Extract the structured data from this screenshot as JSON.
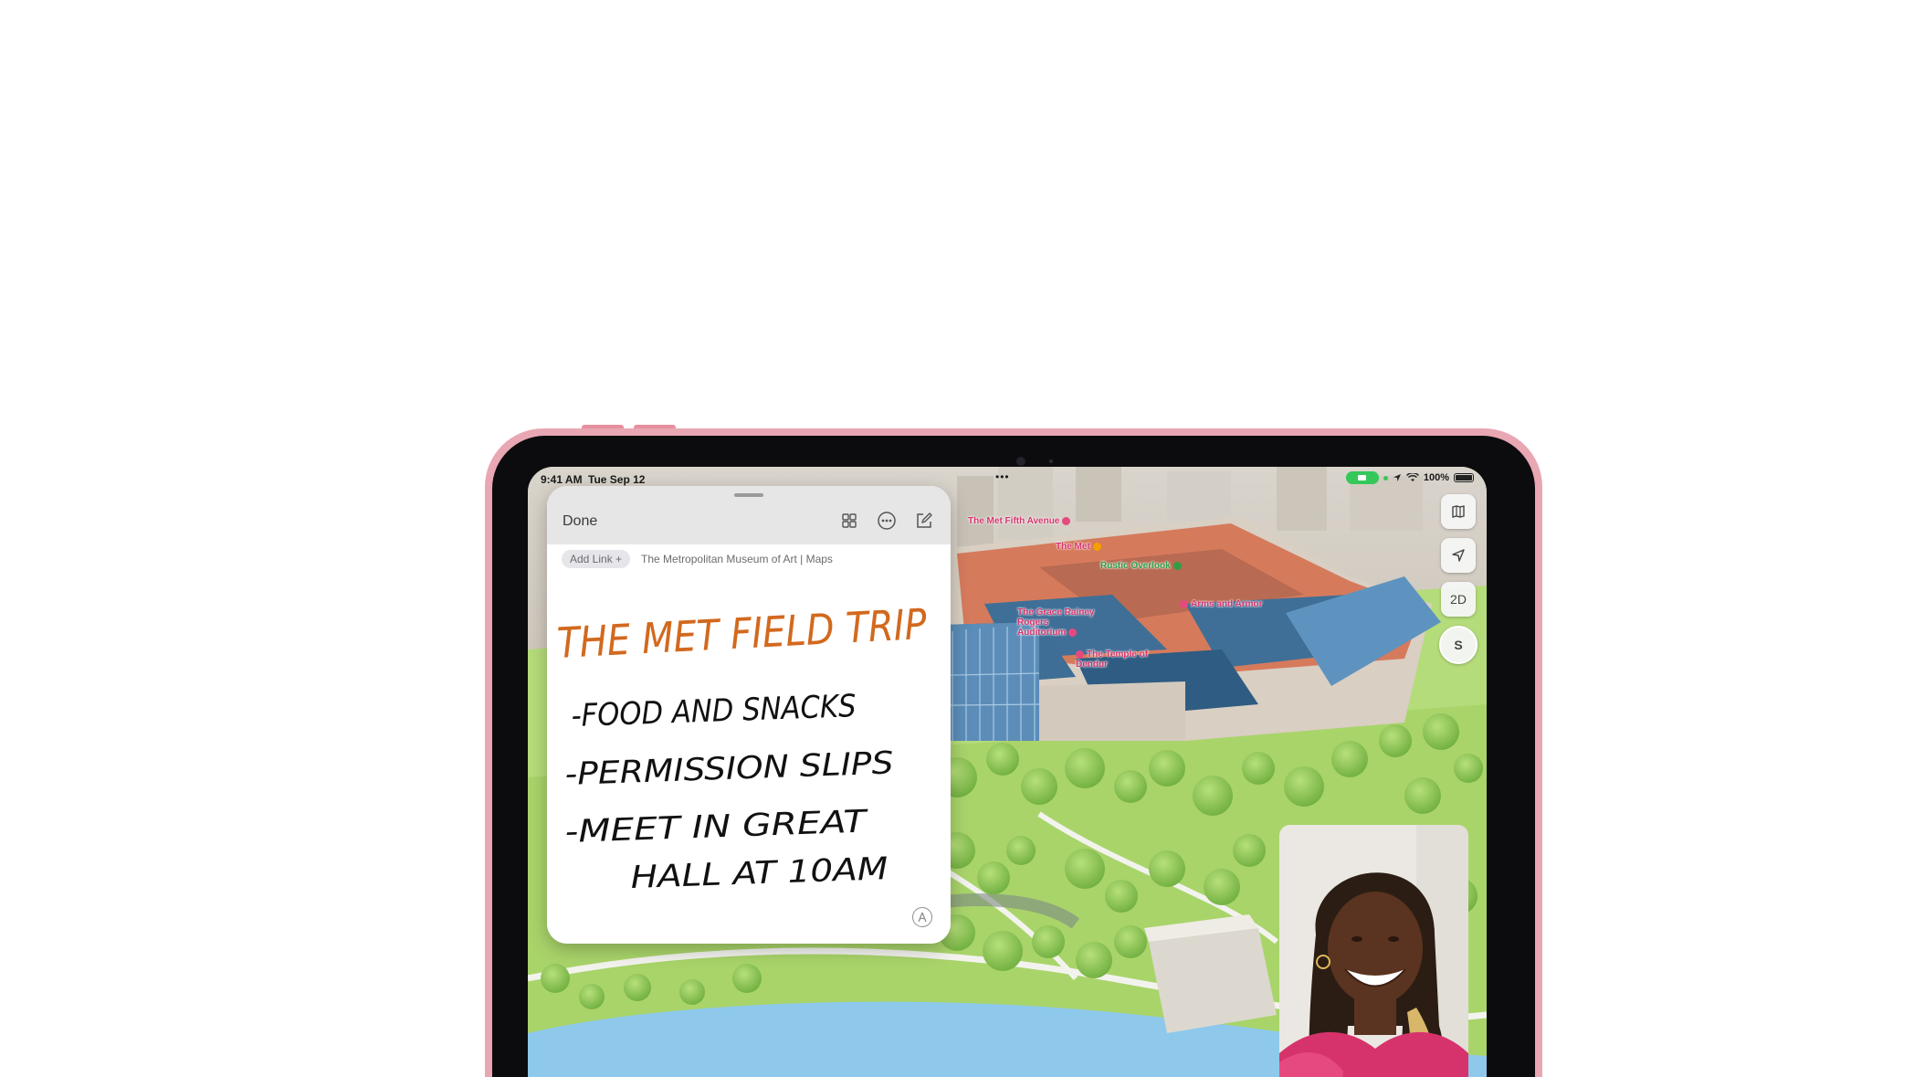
{
  "status_bar": {
    "time": "9:41 AM",
    "date": "Tue Sep 12",
    "multitask_dots": "•••",
    "battery_percent": "100%",
    "icons": [
      "camera-indicator-icon",
      "location-arrow-icon",
      "wifi-icon",
      "battery-icon"
    ]
  },
  "notes": {
    "done_label": "Done",
    "add_link_label": "Add Link +",
    "link_title": "The Metropolitan Museum of Art | Maps",
    "handwriting": {
      "title": "THE MET FIELD TRIP",
      "items": [
        "-FOOD AND SNACKS",
        "-PERMISSION SLIPS",
        "-MEET IN GREAT",
        "HALL AT 10AM"
      ]
    },
    "icons": [
      "gallery-grid-icon",
      "more-ellipsis-icon",
      "compose-icon",
      "markup-icon"
    ]
  },
  "map": {
    "pois": [
      {
        "label": "The Met Fifth Avenue",
        "color": "#d6336c"
      },
      {
        "label": "The Met",
        "color": "#d6336c"
      },
      {
        "label": "Rustic Overlook",
        "color": "#2f9e44"
      },
      {
        "label": "Arms and Armor",
        "color": "#d6336c"
      },
      {
        "label": "The Grace Rainey Rogers Auditorium",
        "color": "#d6336c"
      },
      {
        "label": "The Temple of Dendur",
        "color": "#d6336c"
      }
    ],
    "controls": {
      "map_mode_icon": "map-icon",
      "locate_icon": "location-arrow-icon",
      "view_toggle_label": "2D",
      "compass_label": "S"
    }
  },
  "colors": {
    "device_pink": "#e9a6b3",
    "ink_orange": "#d2691e",
    "ink_black": "#111111",
    "park_green": "#a9d46a",
    "water_blue": "#8ec9ec"
  }
}
